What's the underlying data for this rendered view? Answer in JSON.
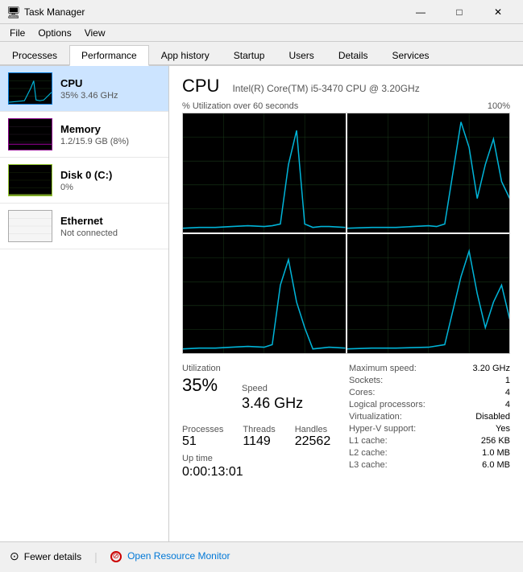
{
  "window": {
    "title": "Task Manager",
    "icon": "⚙"
  },
  "title_controls": {
    "minimize": "—",
    "maximize": "□",
    "close": "✕"
  },
  "menu": {
    "items": [
      "File",
      "Options",
      "View"
    ]
  },
  "tabs": [
    {
      "id": "processes",
      "label": "Processes"
    },
    {
      "id": "performance",
      "label": "Performance",
      "active": true
    },
    {
      "id": "app-history",
      "label": "App history"
    },
    {
      "id": "startup",
      "label": "Startup"
    },
    {
      "id": "users",
      "label": "Users"
    },
    {
      "id": "details",
      "label": "Details"
    },
    {
      "id": "services",
      "label": "Services"
    }
  ],
  "sidebar": {
    "items": [
      {
        "id": "cpu",
        "name": "CPU",
        "detail": "35% 3.46 GHz",
        "type": "cpu",
        "active": true
      },
      {
        "id": "memory",
        "name": "Memory",
        "detail": "1.2/15.9 GB (8%)",
        "type": "memory",
        "active": false
      },
      {
        "id": "disk",
        "name": "Disk 0 (C:)",
        "detail": "0%",
        "type": "disk",
        "active": false
      },
      {
        "id": "ethernet",
        "name": "Ethernet",
        "detail": "Not connected",
        "type": "ethernet",
        "active": false
      }
    ]
  },
  "cpu_panel": {
    "title": "CPU",
    "model": "Intel(R) Core(TM) i5-3470 CPU @ 3.20GHz",
    "chart_label": "% Utilization over 60 seconds",
    "chart_max": "100%",
    "utilization_label": "Utilization",
    "utilization_value": "35%",
    "speed_label": "Speed",
    "speed_value": "3.46 GHz",
    "processes_label": "Processes",
    "processes_value": "51",
    "threads_label": "Threads",
    "threads_value": "1149",
    "handles_label": "Handles",
    "handles_value": "22562",
    "uptime_label": "Up time",
    "uptime_value": "0:00:13:01",
    "info": {
      "max_speed_label": "Maximum speed:",
      "max_speed_value": "3.20 GHz",
      "sockets_label": "Sockets:",
      "sockets_value": "1",
      "cores_label": "Cores:",
      "cores_value": "4",
      "logical_label": "Logical processors:",
      "logical_value": "4",
      "virt_label": "Virtualization:",
      "virt_value": "Disabled",
      "hyperv_label": "Hyper-V support:",
      "hyperv_value": "Yes",
      "l1_label": "L1 cache:",
      "l1_value": "256 KB",
      "l2_label": "L2 cache:",
      "l2_value": "1.0 MB",
      "l3_label": "L3 cache:",
      "l3_value": "6.0 MB"
    }
  },
  "bottom": {
    "fewer_details": "Fewer details",
    "open_monitor": "Open Resource Monitor"
  }
}
